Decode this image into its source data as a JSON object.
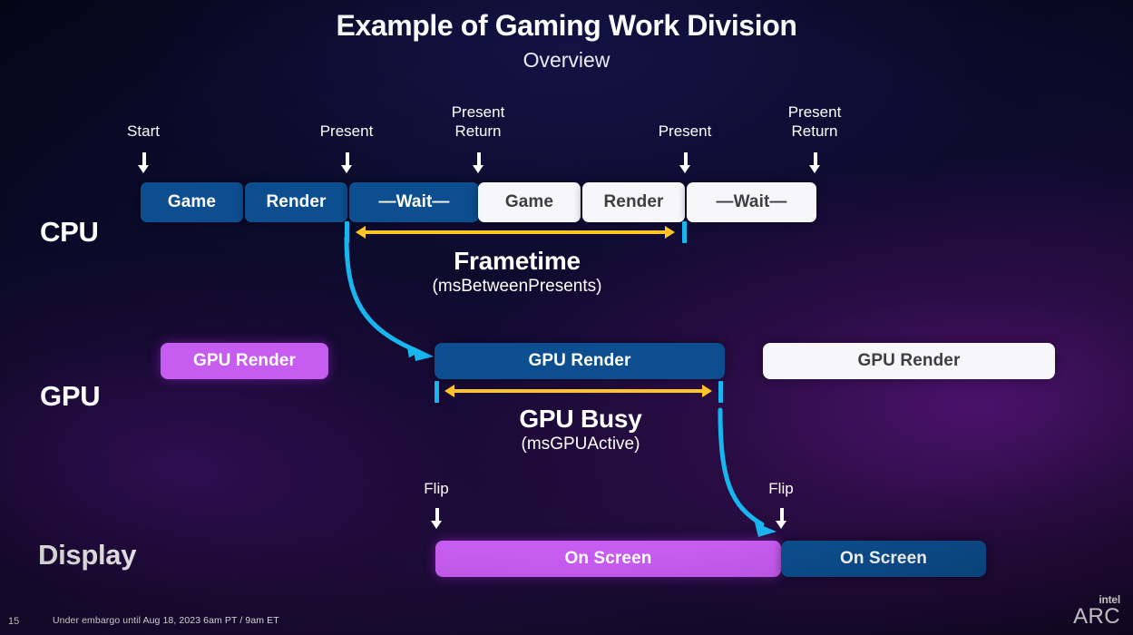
{
  "header": {
    "title": "Example of Gaming Work Division",
    "subtitle": "Overview"
  },
  "rows": {
    "cpu_label": "CPU",
    "gpu_label": "GPU",
    "display_label": "Display"
  },
  "cpu": {
    "markers": [
      {
        "text": "Start"
      },
      {
        "text": "Present"
      },
      {
        "text": "Present\nReturn"
      },
      {
        "text": "Present"
      },
      {
        "text": "Present\nReturn"
      }
    ],
    "blocks": [
      {
        "label": "Game",
        "style": "blue"
      },
      {
        "label": "Render",
        "style": "blue"
      },
      {
        "label": "—Wait—",
        "style": "blue"
      },
      {
        "label": "Game",
        "style": "white"
      },
      {
        "label": "Render",
        "style": "white"
      },
      {
        "label": "—Wait—",
        "style": "white"
      }
    ],
    "annotation": {
      "title": "Frametime",
      "metric": "(msBetweenPresents)"
    }
  },
  "gpu": {
    "blocks": [
      {
        "label": "GPU Render",
        "style": "purple"
      },
      {
        "label": "GPU Render",
        "style": "blue"
      },
      {
        "label": "GPU Render",
        "style": "white"
      }
    ],
    "annotation": {
      "title": "GPU Busy",
      "metric": "(msGPUActive)"
    }
  },
  "display": {
    "markers": [
      {
        "text": "Flip"
      },
      {
        "text": "Flip"
      }
    ],
    "blocks": [
      {
        "label": "On Screen",
        "style": "purple"
      },
      {
        "label": "On Screen",
        "style": "blue"
      }
    ]
  },
  "footer": {
    "page_number": "15",
    "embargo": "Under embargo until Aug 18, 2023 6am PT / 9am ET",
    "logo_intel": "intel",
    "logo_arc": "ARC"
  },
  "colors": {
    "blue_block": "#0c4e8f",
    "white_block": "#f7f7f9",
    "purple_block": "#c75cf0",
    "cyan_accent": "#18b6ef",
    "yellow_accent": "#ffc526"
  }
}
